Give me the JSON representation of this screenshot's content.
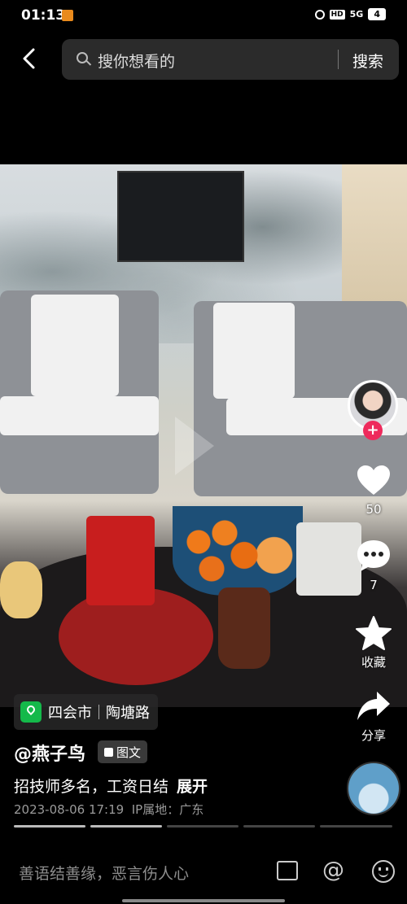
{
  "status": {
    "time": "01:13",
    "network": "5G",
    "battery": "4"
  },
  "search": {
    "placeholder": "搜你想看的",
    "button": "搜索"
  },
  "actions": {
    "likes": "50",
    "comments": "7",
    "favorite_label": "收藏",
    "share_label": "分享"
  },
  "location": {
    "city": "四会市",
    "road": "陶塘路"
  },
  "post": {
    "author": "@燕子鸟",
    "type_label": "图文",
    "caption": "招技师多名，工资日结",
    "expand_label": "展开",
    "datetime": "2023-08-06 17:19",
    "ip_label": "IP属地：广东"
  },
  "progress": {
    "total_pages": 5,
    "active_page": 2
  },
  "comment_bar": {
    "placeholder": "善语结善缘，恶言伤人心"
  },
  "colors": {
    "accent_pink": "#ee2a5c",
    "location_green": "#14b94a"
  }
}
